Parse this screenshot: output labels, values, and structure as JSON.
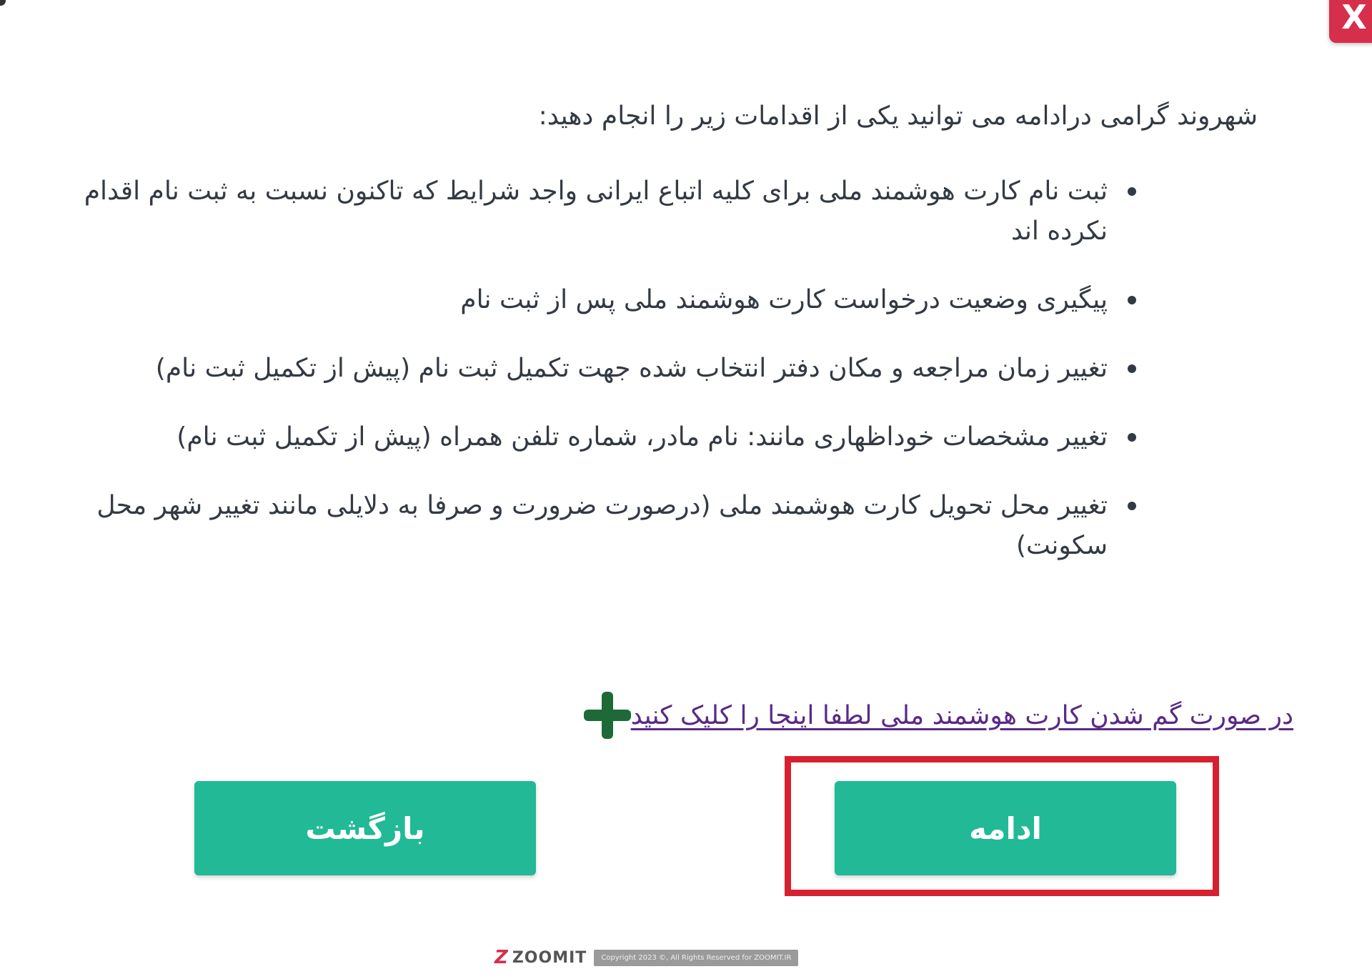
{
  "close_button": {
    "label": "X"
  },
  "intro_text": "شهروند گرامی درادامه می توانید یکی از اقدامات زیر را انجام دهید:",
  "items": [
    "ثبت نام کارت هوشمند ملی برای کلیه اتباع ایرانی واجد شرایط که تاکنون نسبت به ثبت نام اقدام نکرده اند",
    "پیگیری وضعیت درخواست کارت هوشمند ملی پس از ثبت نام",
    "تغییر زمان مراجعه و مکان دفتر انتخاب شده جهت تکمیل ثبت نام (پیش از تکمیل ثبت نام)",
    "تغییر مشخصات خوداظهاری مانند: نام مادر، شماره تلفن همراه (پیش از تکمیل ثبت نام)",
    "تغییر محل تحویل کارت هوشمند ملی (درصورت ضرورت و صرفا به دلایلی مانند تغییر شهر محل سکونت)"
  ],
  "lost_card": {
    "icon": "plus-icon",
    "link_text": "در صورت گم شدن کارت هوشمند ملی لطفا اینجا را کلیک کنید"
  },
  "buttons": {
    "continue_label": "ادامه",
    "back_label": "بازگشت"
  },
  "footer": {
    "logo_letter": "Z",
    "logo_text": "ZOOMIT",
    "copyright": "Copyright 2023 ©, All Rights Reserved for ZOOMIT.IR"
  },
  "colors": {
    "button": "#21b996",
    "close": "#d62f4b",
    "highlight": "#d7202f",
    "link": "#5a2a87",
    "plus": "#1d6a38",
    "text": "#333a44"
  }
}
